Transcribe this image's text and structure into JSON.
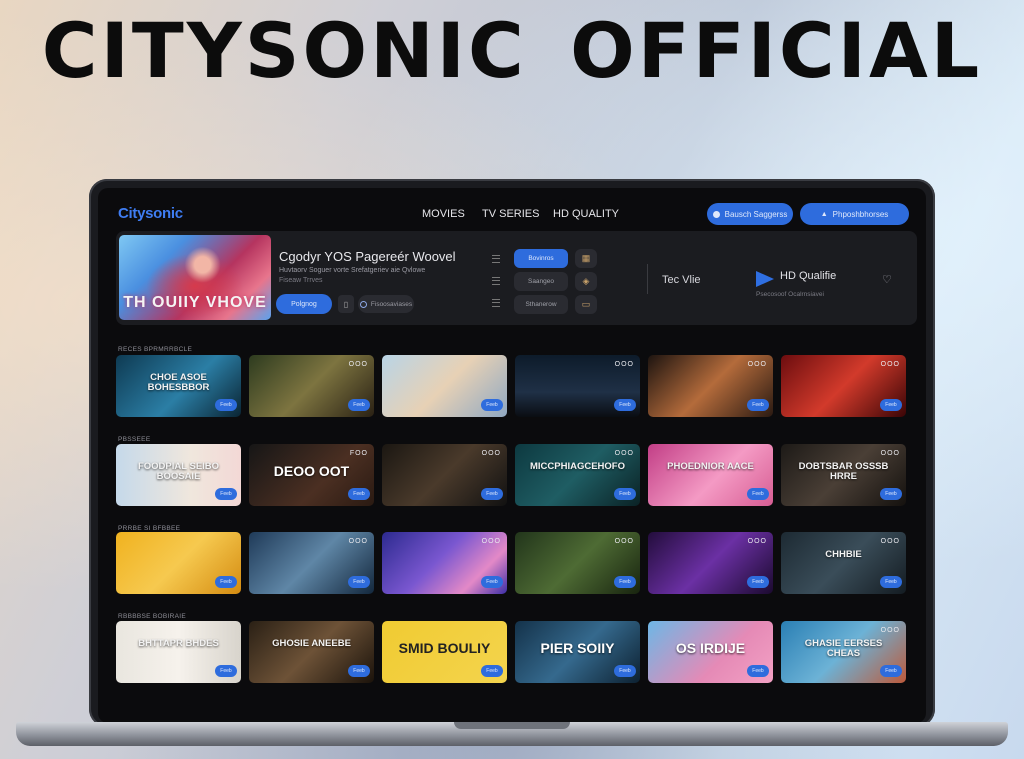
{
  "headline": "CITYSONIC  OFFICIAL",
  "nav": {
    "logo": "Citysonic",
    "links": [
      "MOVIES",
      "TV SERIES",
      "HD QUALITY"
    ],
    "buttons": [
      "Bausch Saggerss",
      "Phposhbhorses"
    ]
  },
  "hero": {
    "poster_text": "TH OUIIY VHOVE",
    "title": "Cgodyr YOS Pagereér Woovel",
    "subtitle": "Huvtaorv Soguer vorte Srefatgeriev aie Qvlowe",
    "subtitle2": "Fiseaw Trrves",
    "play_label": "Polgnog",
    "chip_label": "Fisoosaviases",
    "options": [
      "Bovinros",
      "Saangeo",
      "Sthanerow"
    ],
    "tec_label": "Tec Vlie",
    "hd_label": "HD Qualifie",
    "hd_sub": "Psecosoof Ocalrnsiavei"
  },
  "rows": [
    {
      "label": "RECES BPRMRRBCLE",
      "cards": [
        {
          "caption": "CHOE ASOE BOHESBBOR",
          "badge": "",
          "btn": "Feeb"
        },
        {
          "caption": "",
          "badge": "OOO",
          "btn": "Feeb"
        },
        {
          "caption": "",
          "badge": "",
          "btn": "Feeb"
        },
        {
          "caption": "",
          "badge": "OOO",
          "btn": "Feeb"
        },
        {
          "caption": "",
          "badge": "OOO",
          "btn": "Feeb"
        },
        {
          "caption": "",
          "badge": "OOO",
          "btn": "Feeb"
        }
      ]
    },
    {
      "label": "PBSSEEE",
      "cards": [
        {
          "caption": "FOODPIAL SEIBO BOOSAIE",
          "badge": "",
          "btn": "Feeb"
        },
        {
          "caption": "DEOO OOT",
          "badge": "FOO",
          "btn": "Feeb"
        },
        {
          "caption": "",
          "badge": "OOO",
          "btn": "Feeb"
        },
        {
          "caption": "MICCPHIAGCEHOFO",
          "badge": "OOO",
          "btn": "Feeb"
        },
        {
          "caption": "PHOEDNIOR AACE",
          "badge": "",
          "btn": "Feeb"
        },
        {
          "caption": "DOBTSBAR OSSSB HRRE",
          "badge": "OOO",
          "btn": "Feeb"
        }
      ]
    },
    {
      "label": "PRRBE SI BFBBEE",
      "cards": [
        {
          "caption": "",
          "badge": "",
          "btn": "Feeb"
        },
        {
          "caption": "",
          "badge": "OOO",
          "btn": "Feeb"
        },
        {
          "caption": "",
          "badge": "OOO",
          "btn": "Feeb"
        },
        {
          "caption": "",
          "badge": "OOO",
          "btn": "Feeb"
        },
        {
          "caption": "",
          "badge": "OOO",
          "btn": "Feeb"
        },
        {
          "caption": "CHHBIE",
          "badge": "OOO",
          "btn": "Feeb"
        }
      ]
    },
    {
      "label": "RBBBBSE BOBIRAIE",
      "cards": [
        {
          "caption": "BHTTAPR BHDES",
          "badge": "",
          "btn": "Feeb"
        },
        {
          "caption": "GHOSIE ANEEBE",
          "badge": "",
          "btn": "Feeb"
        },
        {
          "caption": "SMID BOULIY",
          "badge": "",
          "btn": "Feeb"
        },
        {
          "caption": "PIER SOIIY",
          "badge": "",
          "btn": "Feeb"
        },
        {
          "caption": "OS IRDIJE",
          "badge": "",
          "btn": "Feeb"
        },
        {
          "caption": "GHASIE EERSES CHEAS",
          "badge": "OOO",
          "btn": "Feeb"
        }
      ]
    }
  ],
  "colors": {
    "accent": "#2e6cdd",
    "logo": "#3f7df2",
    "screen": "#0b0b0d",
    "panel": "#1b1c20"
  }
}
